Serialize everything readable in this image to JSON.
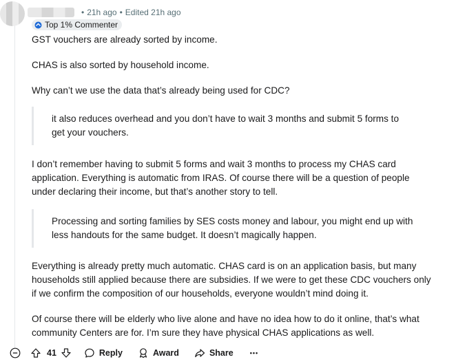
{
  "comment": {
    "time_ago": "21h ago",
    "separator": "•",
    "edited": "Edited 21h ago",
    "flair": "Top 1% Commenter",
    "paragraphs": [
      [
        "GST vouchers are already sorted by income."
      ],
      [
        "CHAS is also sorted by household income."
      ],
      [
        "Why can’t we use the data that’s already being used for CDC?"
      ],
      [
        "I don’t remember having to submit 5 forms and wait 3 months to process my CHAS card",
        "application. Everything is automatic from IRAS. Of course there will be a question of people",
        "under declaring their income, but that’s another story to tell."
      ],
      [
        "Everything is already pretty much automatic. CHAS card is on an application basis, but many",
        "households still applied because there are subsidies. If we were to get these CDC vouchers only",
        "if we confirm the composition of our households, everyone wouldn’t mind doing it."
      ],
      [
        "Of course there will be elderly who live alone and have no idea how to do it online, that’s what",
        "community Centers are for. I’m sure they have physical CHAS applications as well."
      ]
    ],
    "quotes": [
      [
        "it also reduces overhead and you don’t have to wait 3 months and submit 5 forms to",
        "get your vouchers."
      ],
      [
        "Processing and sorting families by SES costs money and labour, you might end up with",
        "less handouts for the same budget. It doesn’t magically happen."
      ]
    ]
  },
  "actions": {
    "vote_count": "41",
    "reply": "Reply",
    "award": "Award",
    "share": "Share",
    "more": "•••"
  }
}
